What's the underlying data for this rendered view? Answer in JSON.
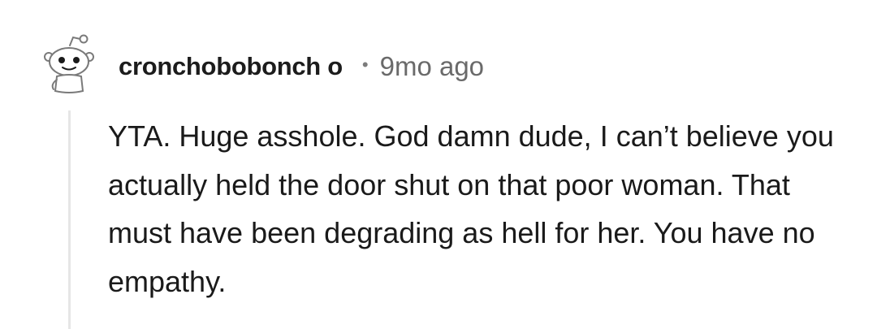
{
  "comment": {
    "username": "cronchobobonch o",
    "separator": "•",
    "timestamp": "9mo ago",
    "body": "YTA. Huge asshole. God damn dude, I can’t believe you actually held the door shut on that poor woman. That must have been degrading as hell for her. You have no empathy.",
    "avatar_icon": "snoo-avatar-icon"
  }
}
